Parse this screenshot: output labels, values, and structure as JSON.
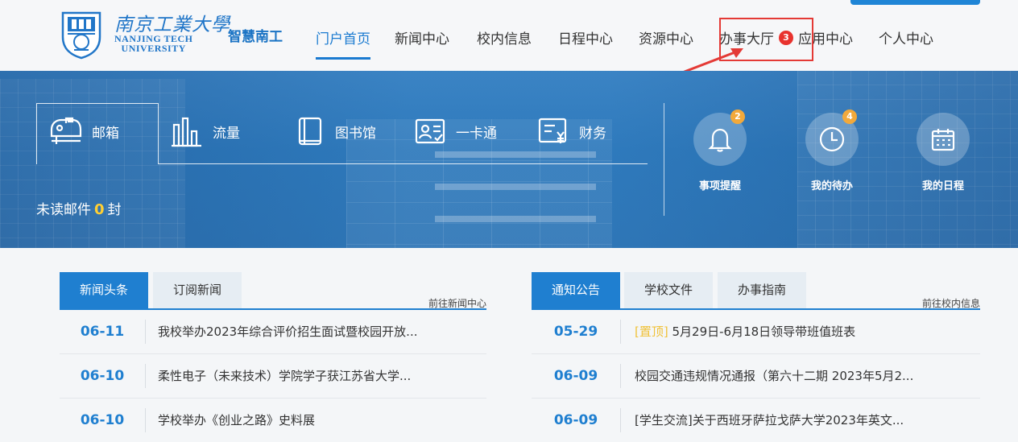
{
  "header": {
    "logo_cn": "南京工業大學",
    "logo_en_line1": "NANJING TECH",
    "logo_en_line2": "UNIVERSITY",
    "brand": "智慧南工",
    "nav": [
      {
        "label": "门户首页",
        "active": true
      },
      {
        "label": "新闻中心"
      },
      {
        "label": "校内信息"
      },
      {
        "label": "日程中心"
      },
      {
        "label": "资源中心"
      },
      {
        "label": "办事大厅",
        "badge": "3"
      },
      {
        "label": "应用中心"
      },
      {
        "label": "个人中心"
      }
    ]
  },
  "banner": {
    "quick_access": [
      {
        "label": "邮箱",
        "icon": "mailbox-icon"
      },
      {
        "label": "流量",
        "icon": "bar-chart-icon"
      },
      {
        "label": "图书馆",
        "icon": "book-icon"
      },
      {
        "label": "一卡通",
        "icon": "id-card-icon"
      },
      {
        "label": "财务",
        "icon": "finance-icon"
      }
    ],
    "unread_prefix": "未读邮件",
    "unread_count": "0",
    "unread_suffix": "封",
    "shortcuts": [
      {
        "label": "事项提醒",
        "badge": "2",
        "icon": "bell-icon"
      },
      {
        "label": "我的待办",
        "badge": "4",
        "icon": "clock-icon"
      },
      {
        "label": "我的日程",
        "icon": "calendar-icon"
      }
    ]
  },
  "news_panel": {
    "tabs": [
      "新闻头条",
      "订阅新闻"
    ],
    "more": "前往新闻中心",
    "rows": [
      {
        "date": "06-11",
        "title": "我校举办2023年综合评价招生面试暨校园开放..."
      },
      {
        "date": "06-10",
        "title": "柔性电子（未来技术）学院学子获江苏省大学..."
      },
      {
        "date": "06-10",
        "title": "学校举办《创业之路》史料展"
      }
    ]
  },
  "notice_panel": {
    "tabs": [
      "通知公告",
      "学校文件",
      "办事指南"
    ],
    "more": "前往校内信息",
    "rows": [
      {
        "date": "05-29",
        "tag": "[置顶]",
        "title": "5月29日-6月18日领导带班值班表"
      },
      {
        "date": "06-09",
        "tag": "",
        "title": "校园交通违规情况通报（第六十二期 2023年5月2..."
      },
      {
        "date": "06-09",
        "tag": "",
        "title": "[学生交流]关于西班牙萨拉戈萨大学2023年英文..."
      }
    ]
  },
  "colors": {
    "accent": "#1f7fd0",
    "badge_red": "#e8322e",
    "badge_orange": "#f2a93b",
    "highlight": "#e43a36"
  }
}
